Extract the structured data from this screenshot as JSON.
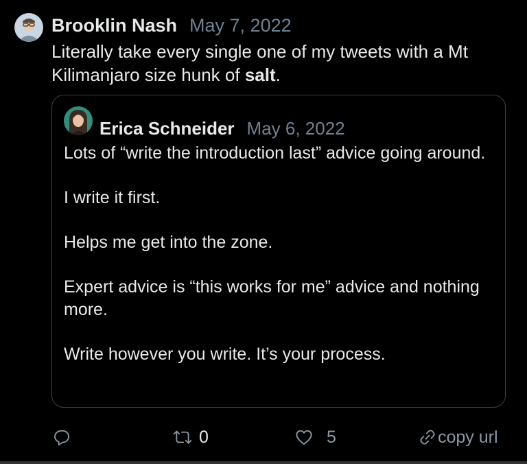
{
  "tweet": {
    "author": "Brooklin Nash",
    "date": "May 7, 2022",
    "text_before": "Literally take every single one of my tweets with a Mt Kilimanjaro size hunk of ",
    "text_bold": "salt",
    "text_after": ".",
    "avatar_icon": "avatar-man-glasses"
  },
  "quoted": {
    "author": "Erica Schneider",
    "date": "May 6, 2022",
    "avatar_icon": "avatar-woman",
    "paragraphs": [
      "Lots of “write the introduction last” advice going around.",
      "I write it first.",
      "Helps me get into the zone.",
      "Expert advice is “this works for me” advice and nothing more.",
      "Write however you write. It’s your process."
    ]
  },
  "actions": {
    "reply_icon": "reply-icon",
    "retweet_icon": "retweet-icon",
    "retweet_count": "0",
    "like_icon": "heart-icon",
    "like_count": "5",
    "copy_icon": "link-icon",
    "copy_label": "copy url"
  },
  "colors": {
    "background": "#000000",
    "text": "#e7e9ea",
    "muted": "#71818f",
    "border": "#3e4144"
  }
}
